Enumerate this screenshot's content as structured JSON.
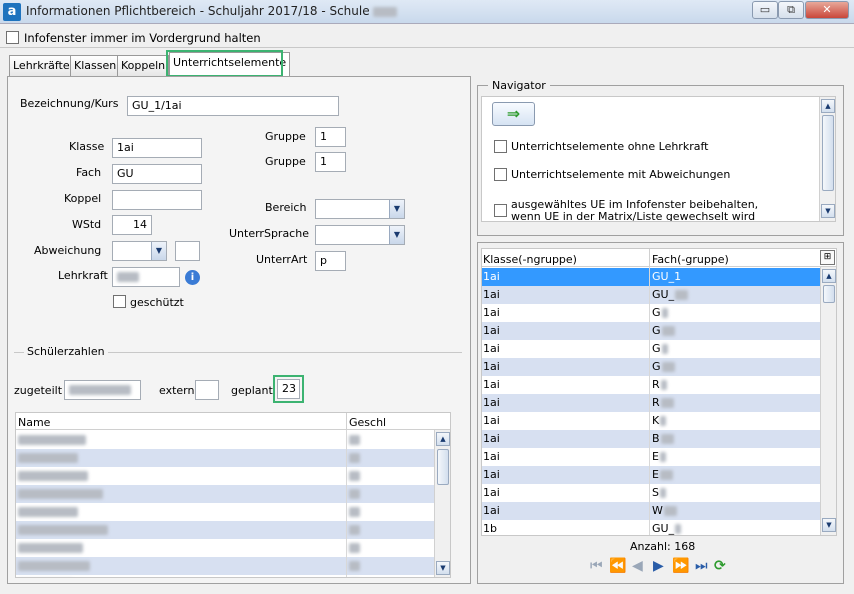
{
  "window": {
    "title": "Informationen Pflichtbereich - Schuljahr 2017/18 - Schule",
    "app_icon": "a",
    "controls": {
      "minimize": "▭",
      "restore": "⧉",
      "close": "✕"
    }
  },
  "always_on_top_label": "Infofenster immer im Vordergrund halten",
  "tabs": [
    {
      "label": "Lehrkräfte"
    },
    {
      "label": "Klassen"
    },
    {
      "label": "Koppeln"
    },
    {
      "label": "Unterrichtselemente",
      "active": true
    }
  ],
  "form": {
    "bezeichnung_label": "Bezeichnung/Kurs",
    "bezeichnung_value": "GU_1/1ai",
    "klasse_label": "Klasse",
    "klasse_value": "1ai",
    "fach_label": "Fach",
    "fach_value": "GU",
    "koppel_label": "Koppel",
    "koppel_value": "",
    "wstd_label": "WStd",
    "wstd_value": "14",
    "abweichung_label": "Abweichung",
    "abweichung_value": "",
    "lehrkraft_label": "Lehrkraft",
    "geschuetzt_label": "geschützt",
    "gruppe1_label": "Gruppe",
    "gruppe1_value": "1",
    "gruppe2_label": "Gruppe",
    "gruppe2_value": "1",
    "bereich_label": "Bereich",
    "unterrsprache_label": "UnterrSprache",
    "unterrart_label": "UnterrArt",
    "unterrart_value": "p"
  },
  "schueler": {
    "section_label": "Schülerzahlen",
    "zugeteilt_label": "zugeteilt",
    "extern_label": "extern",
    "extern_value": "",
    "geplant_label": "geplant",
    "geplant_value": "23",
    "columns": {
      "name": "Name",
      "geschl": "Geschl"
    }
  },
  "navigator": {
    "title": "Navigator",
    "arrow_icon": "⇒",
    "options": [
      "Unterrichtselemente ohne Lehrkraft",
      "Unterrichtselemente mit Abweichungen",
      "ausgewähltes UE im Infofenster beibehalten,",
      "wenn UE in der Matrix/Liste gewechselt wird"
    ]
  },
  "ue_list": {
    "columns": {
      "klasse": "Klasse(-ngruppe)",
      "fach": "Fach(-gruppe)"
    },
    "rows": [
      {
        "klasse": "1ai",
        "fach": "GU_1"
      },
      {
        "klasse": "1ai",
        "fach": "GU_"
      },
      {
        "klasse": "1ai",
        "fach": "G"
      },
      {
        "klasse": "1ai",
        "fach": "G"
      },
      {
        "klasse": "1ai",
        "fach": "G"
      },
      {
        "klasse": "1ai",
        "fach": "G"
      },
      {
        "klasse": "1ai",
        "fach": "R"
      },
      {
        "klasse": "1ai",
        "fach": "R"
      },
      {
        "klasse": "1ai",
        "fach": "K"
      },
      {
        "klasse": "1ai",
        "fach": "B"
      },
      {
        "klasse": "1ai",
        "fach": "E"
      },
      {
        "klasse": "1ai",
        "fach": "E"
      },
      {
        "klasse": "1ai",
        "fach": "S"
      },
      {
        "klasse": "1ai",
        "fach": "W"
      },
      {
        "klasse": "1b",
        "fach": "GU_"
      }
    ],
    "count_label": "Anzahl: 168"
  },
  "nav_buttons": {
    "first": "⏮",
    "prev_page": "⏪",
    "prev": "◀",
    "next": "▶",
    "next_page": "⏩",
    "last": "⏭",
    "refresh": "⟳"
  },
  "colors": {
    "accent_green": "#3cb371",
    "selection": "#3399ff",
    "alt_row": "#d7e0f1",
    "info_icon": "#3a7bd5"
  }
}
